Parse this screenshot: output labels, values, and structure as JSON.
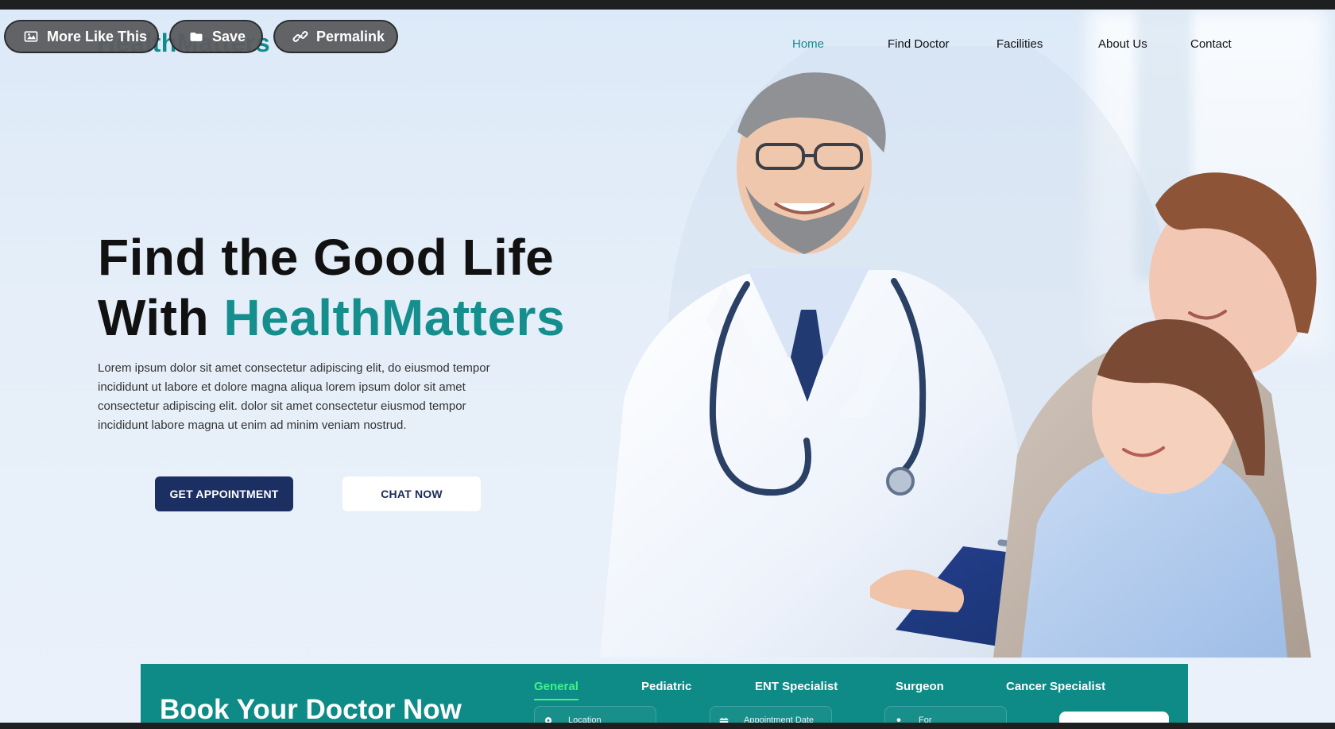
{
  "site": {
    "logo": "HealthMatters"
  },
  "toolbar": {
    "more_like_this": "More Like This",
    "save": "Save",
    "permalink": "Permalink"
  },
  "nav": {
    "items": [
      {
        "label": "Home"
      },
      {
        "label": "Find Doctor"
      },
      {
        "label": "Facilities"
      },
      {
        "label": "About Us"
      },
      {
        "label": "Contact"
      }
    ]
  },
  "hero": {
    "title_line_1": "Find the Good Life",
    "title_line_2_prefix": "With ",
    "title_line_2_accent": "HealthMatters",
    "description_lines": [
      "Lorem ipsum dolor sit amet consectetur adipiscing elit, do eiusmod tempor",
      "incididunt ut labore et dolore magna aliqua lorem ipsum dolor sit amet",
      "consectetur adipiscing elit. dolor sit amet consectetur eiusmod tempor",
      "incididunt labore magna ut enim ad minim veniam nostrud."
    ],
    "primary_button": "GET APPOINTMENT",
    "secondary_button": "CHAT NOW"
  },
  "booking": {
    "title": "Book Your Doctor Now",
    "tabs": [
      {
        "label": "General"
      },
      {
        "label": "Pediatric"
      },
      {
        "label": "ENT Specialist"
      },
      {
        "label": "Surgeon"
      },
      {
        "label": "Cancer Specialist"
      }
    ],
    "fields": [
      {
        "label": "Location"
      },
      {
        "label": "Appointment Date"
      },
      {
        "label": "For"
      }
    ]
  },
  "colors": {
    "accent": "#158F8D",
    "navy": "#1C2F63",
    "booking_panel": "#0F8B87",
    "active_tab": "#42F08A"
  },
  "icons": {
    "toolbar_more": "image-icon",
    "toolbar_save": "folder-icon",
    "toolbar_permalink": "link-icon",
    "location": "location-pin-icon",
    "calendar": "calendar-icon",
    "user": "user-icon"
  }
}
